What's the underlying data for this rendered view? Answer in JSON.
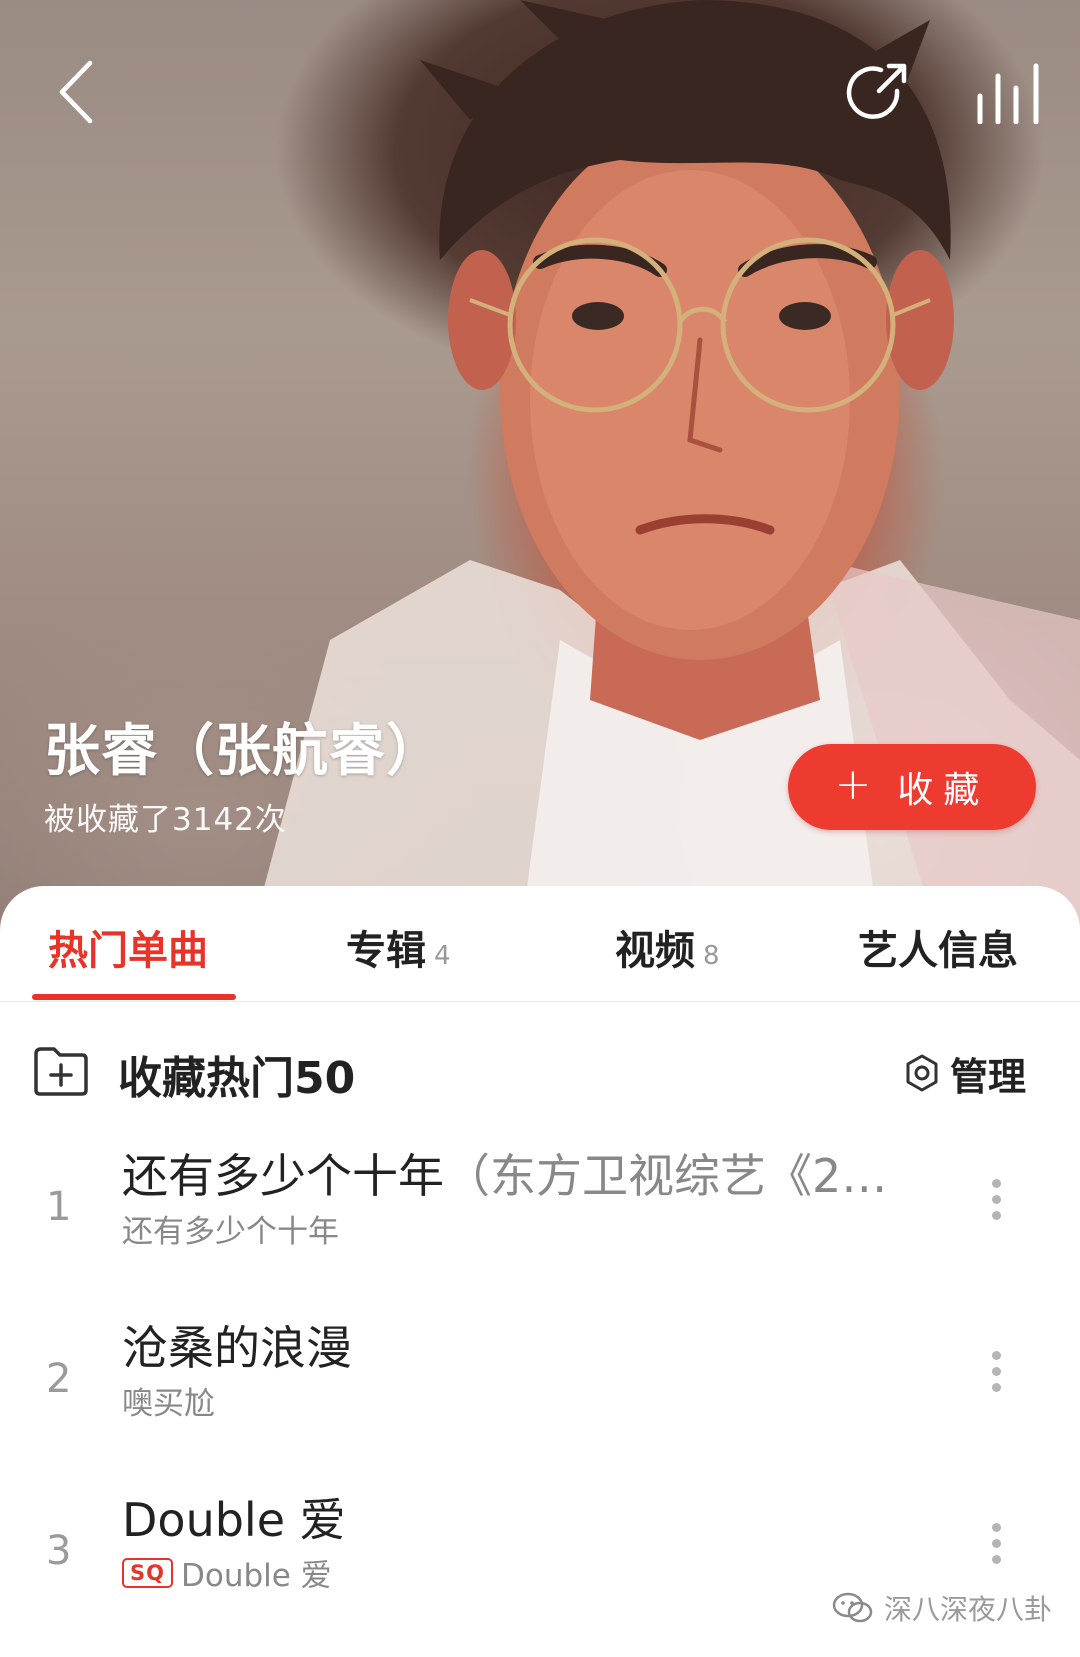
{
  "artist": {
    "name": "张睿（张航睿）",
    "favorited_text": "被收藏了3142次"
  },
  "follow_button": {
    "plus": "+",
    "label": "收藏"
  },
  "tabs": [
    {
      "label": "热门单曲",
      "count": ""
    },
    {
      "label": "专辑",
      "count": "4"
    },
    {
      "label": "视频",
      "count": "8"
    },
    {
      "label": "艺人信息",
      "count": ""
    }
  ],
  "collect_row": {
    "label": "收藏热门50",
    "manage_label": "管理"
  },
  "songs": [
    {
      "index": "1",
      "title": "还有多少个十年",
      "title_extra": "（东方卫视综艺《2…",
      "subtitle": "还有多少个十年",
      "badge": ""
    },
    {
      "index": "2",
      "title": "沧桑的浪漫",
      "title_extra": "",
      "subtitle": "噢买尬",
      "badge": ""
    },
    {
      "index": "3",
      "title": "Double 爱",
      "title_extra": "",
      "subtitle": "Double 爱",
      "badge": "SQ"
    }
  ],
  "watermark": "深八深夜八卦",
  "colors": {
    "accent": "#e83428",
    "follow_button": "#ee3b2f"
  },
  "icons": [
    "back-icon",
    "share-icon",
    "equalizer-icon",
    "add-folder-icon",
    "gear-icon",
    "more-icon",
    "wechat-icon"
  ]
}
